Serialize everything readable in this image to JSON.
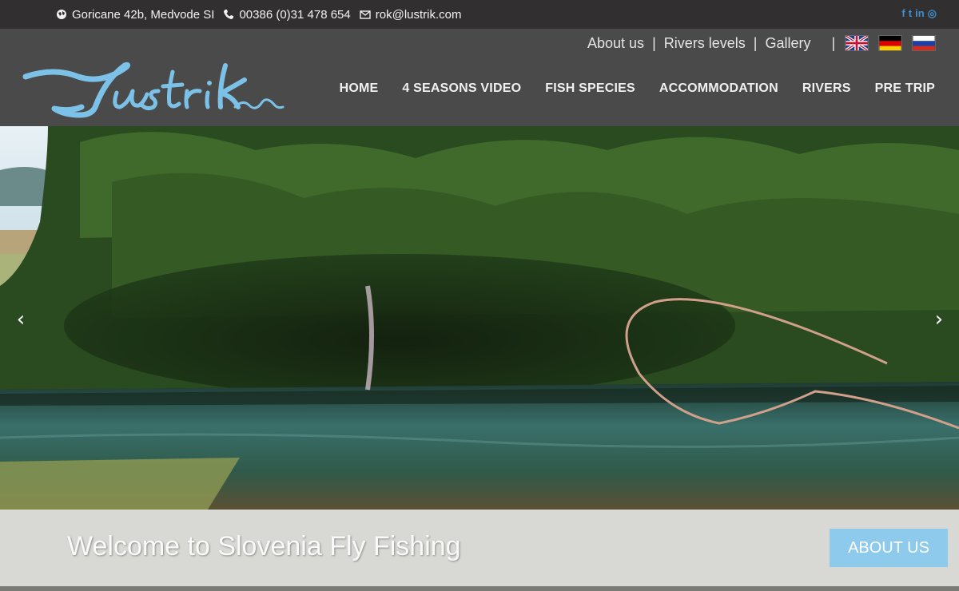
{
  "topbar": {
    "address": "Goricane 42b, Medvode SI",
    "phone": "00386 (0)31 478 654",
    "email": "rok@lustrik.com",
    "social": [
      "facebook-icon",
      "twitter-icon",
      "linkedin-icon",
      "instagram-icon"
    ],
    "social_glyphs": [
      "f",
      "t",
      "in",
      "◎"
    ]
  },
  "brand": {
    "logo_text": "Lustrik",
    "logo_color": "#7cc2e8"
  },
  "util_nav": {
    "about": "About us",
    "rivers": "Rivers levels",
    "gallery": "Gallery",
    "separator": "|"
  },
  "languages": [
    "english-flag-icon",
    "german-flag-icon",
    "russian-flag-icon"
  ],
  "main_nav": [
    "HOME",
    "4 SEASONS VIDEO",
    "FISH SPECIES",
    "ACCOMMODATION",
    "RIVERS",
    "PRE TRIP"
  ],
  "hero": {
    "prev_icon": "chevron-left-icon",
    "next_icon": "chevron-right-icon"
  },
  "welcome": {
    "title": "Welcome to Slovenia Fly Fishing",
    "button": "ABOUT US"
  },
  "colors": {
    "accent": "#8ecaec",
    "topbar": "#312f2f",
    "header": "#4a4a4a",
    "social": "#3f8fd0"
  }
}
